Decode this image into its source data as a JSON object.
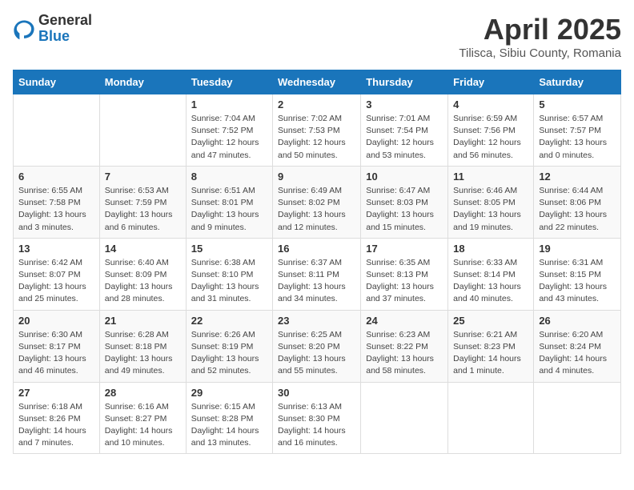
{
  "header": {
    "logo_general": "General",
    "logo_blue": "Blue",
    "title": "April 2025",
    "subtitle": "Tilisca, Sibiu County, Romania"
  },
  "calendar": {
    "days_of_week": [
      "Sunday",
      "Monday",
      "Tuesday",
      "Wednesday",
      "Thursday",
      "Friday",
      "Saturday"
    ],
    "weeks": [
      [
        {
          "day": "",
          "info": ""
        },
        {
          "day": "",
          "info": ""
        },
        {
          "day": "1",
          "info": "Sunrise: 7:04 AM\nSunset: 7:52 PM\nDaylight: 12 hours and 47 minutes."
        },
        {
          "day": "2",
          "info": "Sunrise: 7:02 AM\nSunset: 7:53 PM\nDaylight: 12 hours and 50 minutes."
        },
        {
          "day": "3",
          "info": "Sunrise: 7:01 AM\nSunset: 7:54 PM\nDaylight: 12 hours and 53 minutes."
        },
        {
          "day": "4",
          "info": "Sunrise: 6:59 AM\nSunset: 7:56 PM\nDaylight: 12 hours and 56 minutes."
        },
        {
          "day": "5",
          "info": "Sunrise: 6:57 AM\nSunset: 7:57 PM\nDaylight: 13 hours and 0 minutes."
        }
      ],
      [
        {
          "day": "6",
          "info": "Sunrise: 6:55 AM\nSunset: 7:58 PM\nDaylight: 13 hours and 3 minutes."
        },
        {
          "day": "7",
          "info": "Sunrise: 6:53 AM\nSunset: 7:59 PM\nDaylight: 13 hours and 6 minutes."
        },
        {
          "day": "8",
          "info": "Sunrise: 6:51 AM\nSunset: 8:01 PM\nDaylight: 13 hours and 9 minutes."
        },
        {
          "day": "9",
          "info": "Sunrise: 6:49 AM\nSunset: 8:02 PM\nDaylight: 13 hours and 12 minutes."
        },
        {
          "day": "10",
          "info": "Sunrise: 6:47 AM\nSunset: 8:03 PM\nDaylight: 13 hours and 15 minutes."
        },
        {
          "day": "11",
          "info": "Sunrise: 6:46 AM\nSunset: 8:05 PM\nDaylight: 13 hours and 19 minutes."
        },
        {
          "day": "12",
          "info": "Sunrise: 6:44 AM\nSunset: 8:06 PM\nDaylight: 13 hours and 22 minutes."
        }
      ],
      [
        {
          "day": "13",
          "info": "Sunrise: 6:42 AM\nSunset: 8:07 PM\nDaylight: 13 hours and 25 minutes."
        },
        {
          "day": "14",
          "info": "Sunrise: 6:40 AM\nSunset: 8:09 PM\nDaylight: 13 hours and 28 minutes."
        },
        {
          "day": "15",
          "info": "Sunrise: 6:38 AM\nSunset: 8:10 PM\nDaylight: 13 hours and 31 minutes."
        },
        {
          "day": "16",
          "info": "Sunrise: 6:37 AM\nSunset: 8:11 PM\nDaylight: 13 hours and 34 minutes."
        },
        {
          "day": "17",
          "info": "Sunrise: 6:35 AM\nSunset: 8:13 PM\nDaylight: 13 hours and 37 minutes."
        },
        {
          "day": "18",
          "info": "Sunrise: 6:33 AM\nSunset: 8:14 PM\nDaylight: 13 hours and 40 minutes."
        },
        {
          "day": "19",
          "info": "Sunrise: 6:31 AM\nSunset: 8:15 PM\nDaylight: 13 hours and 43 minutes."
        }
      ],
      [
        {
          "day": "20",
          "info": "Sunrise: 6:30 AM\nSunset: 8:17 PM\nDaylight: 13 hours and 46 minutes."
        },
        {
          "day": "21",
          "info": "Sunrise: 6:28 AM\nSunset: 8:18 PM\nDaylight: 13 hours and 49 minutes."
        },
        {
          "day": "22",
          "info": "Sunrise: 6:26 AM\nSunset: 8:19 PM\nDaylight: 13 hours and 52 minutes."
        },
        {
          "day": "23",
          "info": "Sunrise: 6:25 AM\nSunset: 8:20 PM\nDaylight: 13 hours and 55 minutes."
        },
        {
          "day": "24",
          "info": "Sunrise: 6:23 AM\nSunset: 8:22 PM\nDaylight: 13 hours and 58 minutes."
        },
        {
          "day": "25",
          "info": "Sunrise: 6:21 AM\nSunset: 8:23 PM\nDaylight: 14 hours and 1 minute."
        },
        {
          "day": "26",
          "info": "Sunrise: 6:20 AM\nSunset: 8:24 PM\nDaylight: 14 hours and 4 minutes."
        }
      ],
      [
        {
          "day": "27",
          "info": "Sunrise: 6:18 AM\nSunset: 8:26 PM\nDaylight: 14 hours and 7 minutes."
        },
        {
          "day": "28",
          "info": "Sunrise: 6:16 AM\nSunset: 8:27 PM\nDaylight: 14 hours and 10 minutes."
        },
        {
          "day": "29",
          "info": "Sunrise: 6:15 AM\nSunset: 8:28 PM\nDaylight: 14 hours and 13 minutes."
        },
        {
          "day": "30",
          "info": "Sunrise: 6:13 AM\nSunset: 8:30 PM\nDaylight: 14 hours and 16 minutes."
        },
        {
          "day": "",
          "info": ""
        },
        {
          "day": "",
          "info": ""
        },
        {
          "day": "",
          "info": ""
        }
      ]
    ]
  }
}
